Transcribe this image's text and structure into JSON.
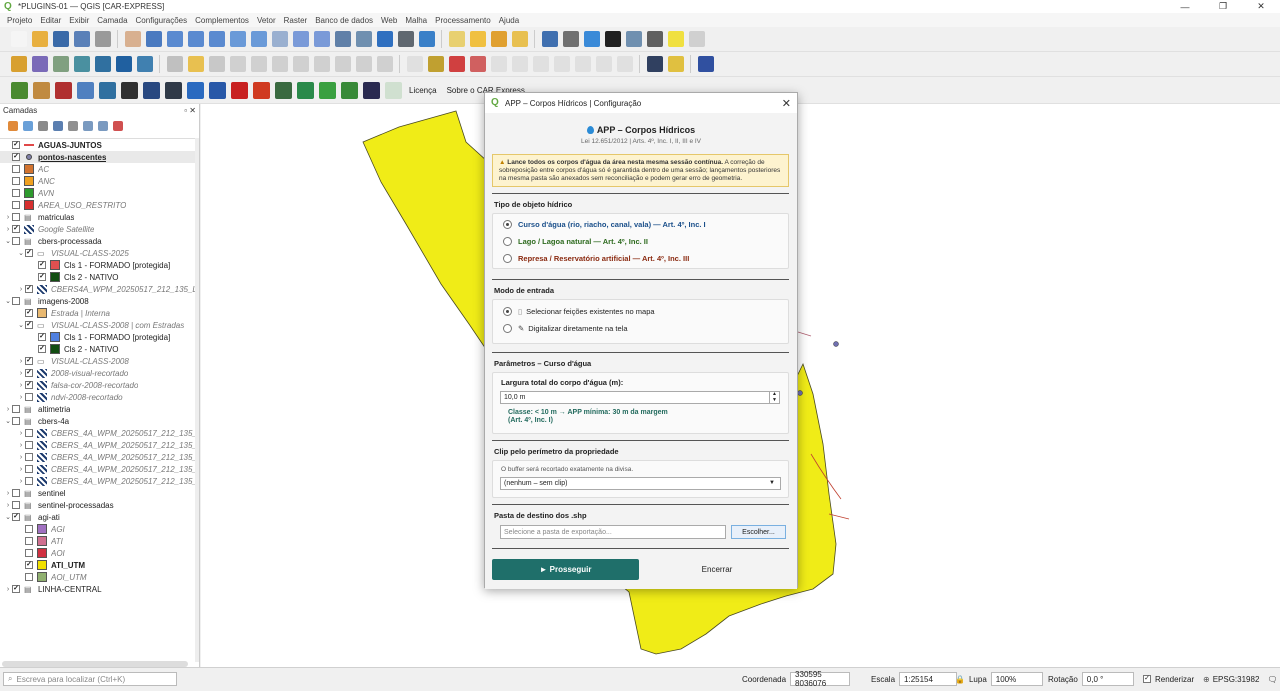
{
  "window": {
    "title": "*PLUGINS-01 — QGIS [CAR-EXPRESS]",
    "logo": "Q",
    "minimize": "—",
    "maximize": "❐",
    "close": "✕"
  },
  "menu": [
    "Projeto",
    "Editar",
    "Exibir",
    "Camada",
    "Configurações",
    "Complementos",
    "Vetor",
    "Raster",
    "Banco de dados",
    "Web",
    "Malha",
    "Processamento",
    "Ajuda"
  ],
  "plugin_toolbar": {
    "licenca": "Licença",
    "sobre": "Sobre o CAR Express"
  },
  "layers_panel": {
    "title": "Camadas",
    "rows": [
      {
        "label": "AGUAS-JUNTOS",
        "indent": 0,
        "arrow": "",
        "checked": true,
        "sym": "line",
        "color": "#e04848",
        "style": "bold"
      },
      {
        "label": "pontos-nascentes",
        "indent": 0,
        "arrow": "",
        "checked": true,
        "sym": "dot",
        "color": "#8080a8",
        "style": "bold-u"
      },
      {
        "label": "AC",
        "indent": 0,
        "arrow": "",
        "checked": false,
        "sym": "swatch",
        "color": "#d2732f",
        "style": "it"
      },
      {
        "label": "ANC",
        "indent": 0,
        "arrow": "",
        "checked": false,
        "sym": "swatch",
        "color": "#f0a020",
        "style": "it"
      },
      {
        "label": "AVN",
        "indent": 0,
        "arrow": "",
        "checked": false,
        "sym": "swatch",
        "color": "#2e9a2e",
        "style": "it"
      },
      {
        "label": "AREA_USO_RESTRITO",
        "indent": 0,
        "arrow": "",
        "checked": false,
        "sym": "swatch",
        "color": "#d63030",
        "style": "it"
      },
      {
        "label": "matriculas",
        "indent": 0,
        "arrow": "›",
        "checked": false,
        "sym": "group",
        "color": "",
        "style": ""
      },
      {
        "label": "Google Satellite",
        "indent": 0,
        "arrow": "›",
        "checked": true,
        "sym": "raster",
        "color": "",
        "style": "it"
      },
      {
        "label": "cbers-processada",
        "indent": 0,
        "arrow": "⌄",
        "checked": false,
        "sym": "group",
        "color": "",
        "style": ""
      },
      {
        "label": "VISUAL-CLASS-2025",
        "indent": 1,
        "arrow": "⌄",
        "checked": true,
        "sym": "vgroup",
        "color": "",
        "style": "it"
      },
      {
        "label": "Cls 1 - FORMADO [protegida]",
        "indent": 2,
        "arrow": "",
        "checked": true,
        "sym": "swatch",
        "color": "#e05050",
        "style": ""
      },
      {
        "label": "Cls 2 - NATIVO",
        "indent": 2,
        "arrow": "",
        "checked": true,
        "sym": "swatch",
        "color": "#124d12",
        "style": ""
      },
      {
        "label": "CBERS4A_WPM_20250517_212_135_L4",
        "indent": 1,
        "arrow": "›",
        "checked": true,
        "sym": "raster",
        "color": "",
        "style": "it"
      },
      {
        "label": "imagens-2008",
        "indent": 0,
        "arrow": "⌄",
        "checked": false,
        "sym": "group",
        "color": "",
        "style": ""
      },
      {
        "label": "Estrada | Interna",
        "indent": 1,
        "arrow": "",
        "checked": true,
        "sym": "swatch",
        "color": "#e8b870",
        "style": "it"
      },
      {
        "label": "VISUAL-CLASS-2008 | com Estradas",
        "indent": 1,
        "arrow": "⌄",
        "checked": true,
        "sym": "vgroup",
        "color": "",
        "style": "it"
      },
      {
        "label": "Cls 1 - FORMADO [protegida]",
        "indent": 2,
        "arrow": "",
        "checked": true,
        "sym": "swatch",
        "color": "#5080e0",
        "style": ""
      },
      {
        "label": "Cls 2 - NATIVO",
        "indent": 2,
        "arrow": "",
        "checked": true,
        "sym": "swatch",
        "color": "#124d12",
        "style": ""
      },
      {
        "label": "VISUAL-CLASS-2008",
        "indent": 1,
        "arrow": "›",
        "checked": true,
        "sym": "vgroup",
        "color": "",
        "style": "it"
      },
      {
        "label": "2008-visual-recortado",
        "indent": 1,
        "arrow": "›",
        "checked": true,
        "sym": "raster",
        "color": "",
        "style": "it"
      },
      {
        "label": "falsa-cor-2008-recortado",
        "indent": 1,
        "arrow": "›",
        "checked": true,
        "sym": "raster",
        "color": "",
        "style": "it"
      },
      {
        "label": "ndvi-2008-recortado",
        "indent": 1,
        "arrow": "›",
        "checked": false,
        "sym": "raster",
        "color": "",
        "style": "it"
      },
      {
        "label": "altimetria",
        "indent": 0,
        "arrow": "›",
        "checked": false,
        "sym": "group",
        "color": "",
        "style": ""
      },
      {
        "label": "cbers-4a",
        "indent": 0,
        "arrow": "⌄",
        "checked": false,
        "sym": "group",
        "color": "",
        "style": ""
      },
      {
        "label": "CBERS_4A_WPM_20250517_212_135_L4",
        "indent": 1,
        "arrow": "›",
        "checked": false,
        "sym": "raster",
        "color": "",
        "style": "it"
      },
      {
        "label": "CBERS_4A_WPM_20250517_212_135_L4",
        "indent": 1,
        "arrow": "›",
        "checked": false,
        "sym": "raster",
        "color": "",
        "style": "it"
      },
      {
        "label": "CBERS_4A_WPM_20250517_212_135_L4",
        "indent": 1,
        "arrow": "›",
        "checked": false,
        "sym": "raster",
        "color": "",
        "style": "it"
      },
      {
        "label": "CBERS_4A_WPM_20250517_212_135_L4",
        "indent": 1,
        "arrow": "›",
        "checked": false,
        "sym": "raster",
        "color": "",
        "style": "it"
      },
      {
        "label": "CBERS_4A_WPM_20250517_212_135_L4",
        "indent": 1,
        "arrow": "›",
        "checked": false,
        "sym": "raster",
        "color": "",
        "style": "it"
      },
      {
        "label": "sentinel",
        "indent": 0,
        "arrow": "›",
        "checked": false,
        "sym": "group",
        "color": "",
        "style": ""
      },
      {
        "label": "sentinel-processadas",
        "indent": 0,
        "arrow": "›",
        "checked": false,
        "sym": "group",
        "color": "",
        "style": ""
      },
      {
        "label": "agi-ati",
        "indent": 0,
        "arrow": "⌄",
        "checked": true,
        "sym": "group",
        "color": "",
        "style": ""
      },
      {
        "label": "AGI",
        "indent": 1,
        "arrow": "",
        "checked": false,
        "sym": "swatch",
        "color": "#a070c0",
        "style": "it"
      },
      {
        "label": "ATI",
        "indent": 1,
        "arrow": "",
        "checked": false,
        "sym": "swatch",
        "color": "#d07090",
        "style": "it"
      },
      {
        "label": "AOI",
        "indent": 1,
        "arrow": "",
        "checked": false,
        "sym": "swatch",
        "color": "#d03040",
        "style": "it"
      },
      {
        "label": "ATI_UTM",
        "indent": 1,
        "arrow": "",
        "checked": true,
        "sym": "swatch",
        "color": "#f0e000",
        "style": "bold"
      },
      {
        "label": "AOI_UTM",
        "indent": 1,
        "arrow": "",
        "checked": false,
        "sym": "swatch",
        "color": "#90b070",
        "style": "it"
      },
      {
        "label": "LINHA-CENTRAL",
        "indent": 0,
        "arrow": "›",
        "checked": true,
        "sym": "group",
        "color": "",
        "style": ""
      }
    ]
  },
  "dialog": {
    "title": "APP – Corpos Hídricos | Configuração",
    "close": "✕",
    "header_title": "APP – Corpos Hídricos",
    "header_sub": "Lei 12.651/2012 | Arts. 4º, Inc. I, II, III e IV",
    "warning_bold": "Lance todos os corpos d'água da área nesta mesma sessão contínua.",
    "warning_rest": " A correção de sobreposição entre corpos d'água só é garantida dentro de uma sessão; lançamentos posteriores na mesma pasta são anexados sem reconciliação e podem gerar erro de geometria.",
    "tipo_title": "Tipo de objeto hídrico",
    "tipo_opts": [
      {
        "label": "Curso d'água  (rio, riacho, canal, vala)  — Art. 4º, Inc. I",
        "selected": true,
        "cls": "lbl-blue"
      },
      {
        "label": "Lago / Lagoa natural  — Art. 4º, Inc. II",
        "selected": false,
        "cls": "lbl-green"
      },
      {
        "label": "Represa / Reservatório artificial  — Art. 4º, Inc. III",
        "selected": false,
        "cls": "lbl-red"
      }
    ],
    "modo_title": "Modo de entrada",
    "modo_opts": [
      {
        "label": "Selecionar feições existentes no mapa",
        "selected": true
      },
      {
        "label": "Digitalizar diretamente na tela",
        "selected": false
      }
    ],
    "param_title": "Parâmetros – Curso d'água",
    "largura_label": "Largura total do corpo d'água (m):",
    "largura_value": "10,0 m",
    "classe_line1": "Classe: < 10 m  →  APP mínima: 30 m da margem",
    "classe_line2": "(Art. 4º, Inc. I)",
    "clip_title": "Clip pelo perímetro da propriedade",
    "clip_note": "O buffer será recortado exatamente na divisa.",
    "clip_value": "(nenhum – sem clip)",
    "pasta_title": "Pasta de destino dos .shp",
    "pasta_placeholder": "Selecione a pasta de exportação...",
    "escolher": "Escolher...",
    "prosseguir": "►  Prosseguir",
    "encerrar": "Encerrar"
  },
  "status": {
    "search_placeholder": "Escreva para localizar (Ctrl+K)",
    "coord_label": "Coordenada",
    "coord_value": "330595  8036076",
    "escala_label": "Escala",
    "escala_value": "1:25154",
    "lupa_label": "Lupa",
    "lupa_value": "100%",
    "rotacao_label": "Rotação",
    "rotacao_value": "0,0 °",
    "render_label": "Renderizar",
    "epsg": "EPSG:31982"
  },
  "colors": {
    "accent": "#1f6f6a",
    "polygon": "#f0ec17",
    "qgis_green": "#62a842"
  }
}
